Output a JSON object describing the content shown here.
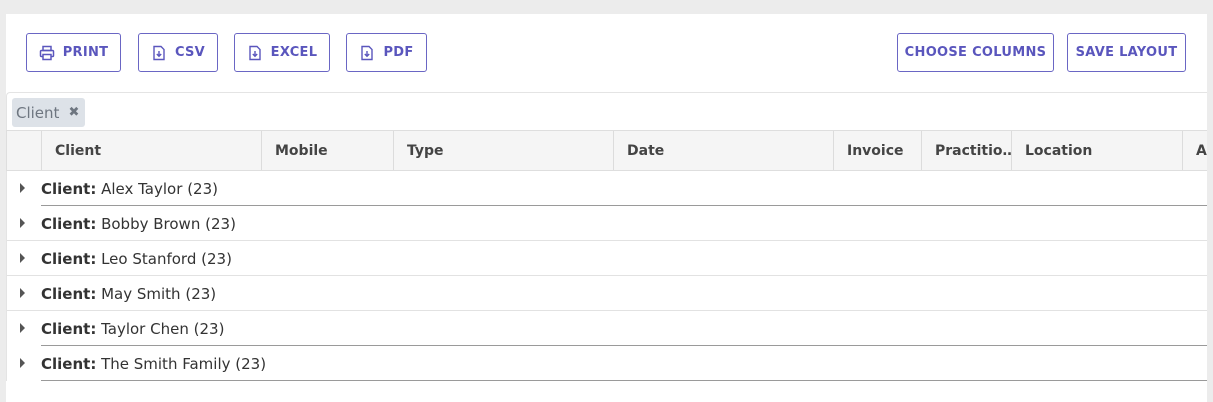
{
  "toolbar": {
    "print_label": "PRINT",
    "csv_label": "CSV",
    "excel_label": "EXCEL",
    "pdf_label": "PDF",
    "choose_columns_label": "CHOOSE COLUMNS",
    "save_layout_label": "SAVE LAYOUT"
  },
  "group_panel": {
    "chip_label": "Client",
    "chip_remove": "✖"
  },
  "columns": [
    "Client",
    "Mobile",
    "Type",
    "Date",
    "Invoice",
    "Practitio…",
    "Location",
    "A"
  ],
  "groups": [
    {
      "key": "Client:",
      "value": "Alex Taylor",
      "count": "(23)"
    },
    {
      "key": "Client:",
      "value": "Bobby Brown",
      "count": "(23)"
    },
    {
      "key": "Client:",
      "value": "Leo Stanford",
      "count": "(23)"
    },
    {
      "key": "Client:",
      "value": "May Smith",
      "count": "(23)"
    },
    {
      "key": "Client:",
      "value": "Taylor Chen",
      "count": "(23)"
    },
    {
      "key": "Client:",
      "value": "The Smith Family",
      "count": "(23)"
    }
  ],
  "colors": {
    "accent": "#5a56bd",
    "chip_bg": "#dde2e8",
    "header_bg": "#f5f5f5"
  }
}
